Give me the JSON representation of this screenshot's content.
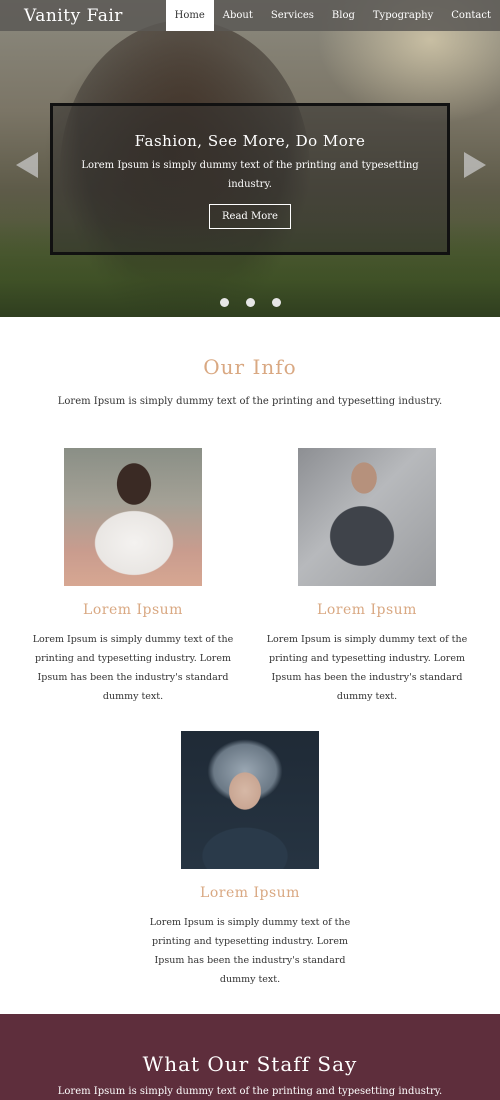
{
  "nav": {
    "brand": "Vanity Fair",
    "links": [
      "Home",
      "About",
      "Services",
      "Blog",
      "Typography",
      "Contact"
    ]
  },
  "hero": {
    "title": "Fashion, See More, Do More",
    "text": "Lorem Ipsum is simply dummy text of the printing and typesetting industry.",
    "button": "Read More",
    "slide_count": 3
  },
  "info": {
    "title": "Our Info",
    "intro": "Lorem Ipsum is simply dummy text of the printing and typesetting industry.",
    "cards": [
      {
        "title": "Lorem Ipsum",
        "text": "Lorem Ipsum is simply dummy text of the printing and typesetting industry. Lorem Ipsum has been the industry's standard dummy text."
      },
      {
        "title": "Lorem Ipsum",
        "text": "Lorem Ipsum is simply dummy text of the printing and typesetting industry. Lorem Ipsum has been the industry's standard dummy text."
      },
      {
        "title": "Lorem Ipsum",
        "text": "Lorem Ipsum is simply dummy text of the printing and typesetting industry. Lorem Ipsum has been the industry's standard dummy text."
      }
    ]
  },
  "staff": {
    "title": "What Our Staff Say",
    "text": "Lorem Ipsum is simply dummy text of the printing and typesetting industry."
  },
  "colors": {
    "accent": "#d9a882",
    "staff_bg": "#5e2e3c",
    "navbar_bg": "#5a5855"
  }
}
